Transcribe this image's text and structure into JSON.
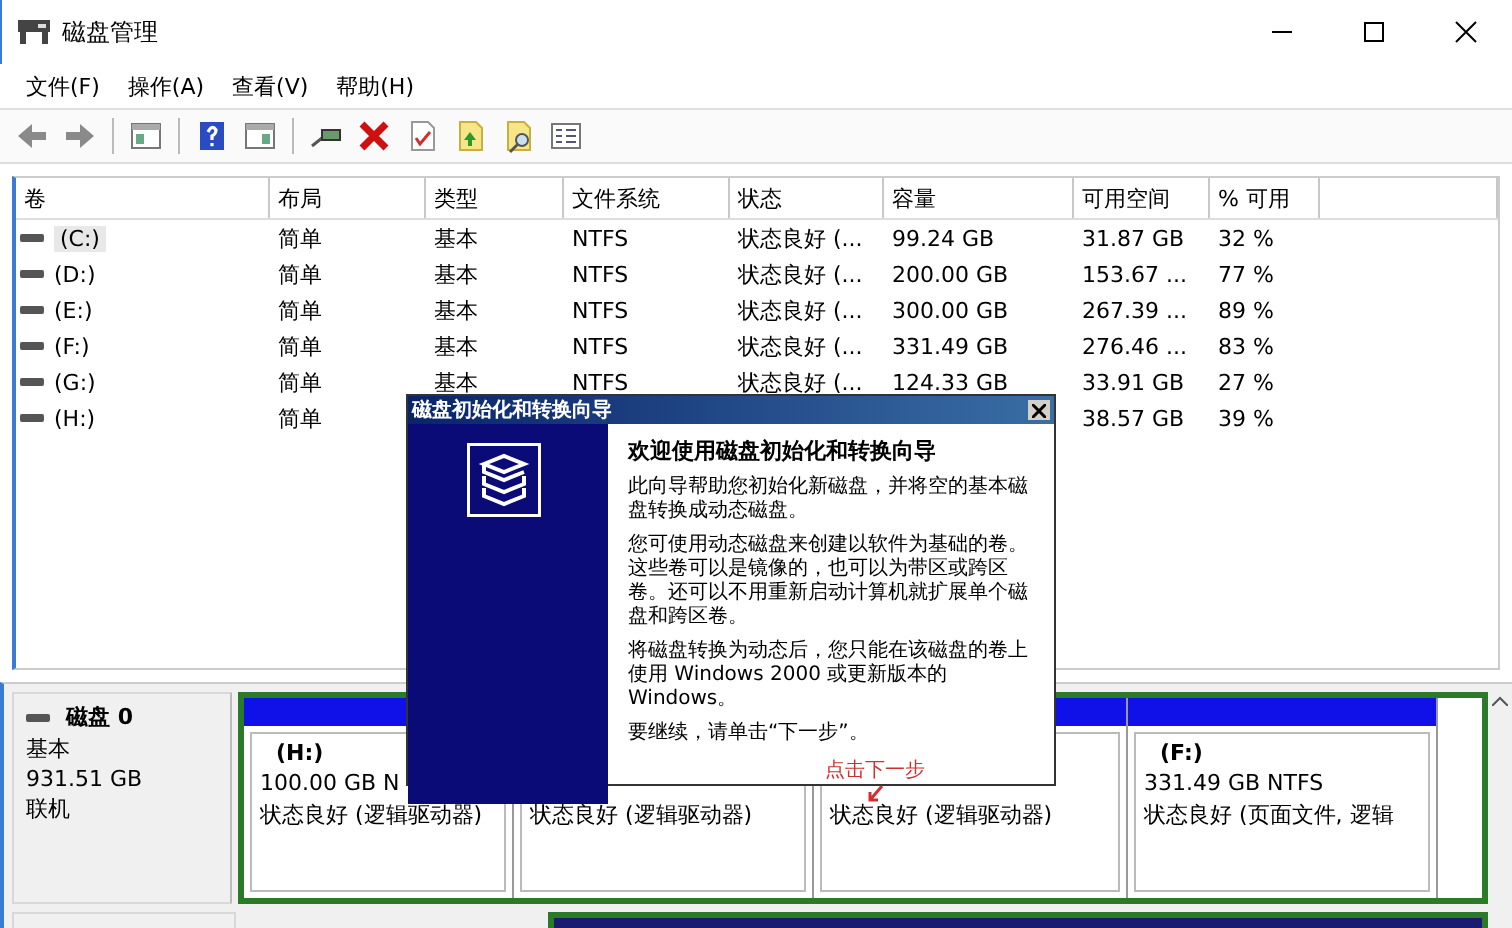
{
  "window": {
    "title": "磁盘管理"
  },
  "menu": [
    "文件(F)",
    "操作(A)",
    "查看(V)",
    "帮助(H)"
  ],
  "table": {
    "columns": [
      "卷",
      "布局",
      "类型",
      "文件系统",
      "状态",
      "容量",
      "可用空间",
      "% 可用"
    ],
    "rows": [
      {
        "selected": true,
        "cells": [
          "(C:)",
          "简单",
          "基本",
          "NTFS",
          "状态良好 (...",
          "99.24 GB",
          "31.87 GB",
          "32 %"
        ]
      },
      {
        "selected": false,
        "cells": [
          "(D:)",
          "简单",
          "基本",
          "NTFS",
          "状态良好 (...",
          "200.00 GB",
          "153.67 ...",
          "77 %"
        ]
      },
      {
        "selected": false,
        "cells": [
          "(E:)",
          "简单",
          "基本",
          "NTFS",
          "状态良好 (...",
          "300.00 GB",
          "267.39 ...",
          "89 %"
        ]
      },
      {
        "selected": false,
        "cells": [
          "(F:)",
          "简单",
          "基本",
          "NTFS",
          "状态良好 (...",
          "331.49 GB",
          "276.46 ...",
          "83 %"
        ]
      },
      {
        "selected": false,
        "cells": [
          "(G:)",
          "简单",
          "基本",
          "NTFS",
          "状态良好 (...",
          "124.33 GB",
          "33.91 GB",
          "27 %"
        ]
      },
      {
        "selected": false,
        "cells": [
          "(H:)",
          "简单",
          null,
          null,
          null,
          null,
          "38.57 GB",
          "39 %"
        ]
      }
    ]
  },
  "disk": {
    "name": "磁盘 0",
    "type": "基本",
    "size": "931.51 GB",
    "status": "联机",
    "partitions": [
      {
        "name": "(H:)",
        "size": "100.00 GB N",
        "status": "状态良好 (逻辑驱动器)"
      },
      {
        "status": "状态良好 (逻辑驱动器)"
      },
      {
        "status": "状态良好 (逻辑驱动器)"
      },
      {
        "name": "(F:)",
        "size": "331.49 GB NTFS",
        "status": "状态良好 (页面文件, 逻辑"
      }
    ]
  },
  "wizard": {
    "title": "磁盘初始化和转换向导",
    "heading": "欢迎使用磁盘初始化和转换向导",
    "paragraphs": [
      "此向导帮助您初始化新磁盘，并将空的基本磁盘转换成动态磁盘。",
      "您可使用动态磁盘来创建以软件为基础的卷。这些卷可以是镜像的，也可以为带区或跨区卷。还可以不用重新启动计算机就扩展单个磁盘和跨区卷。",
      "将磁盘转换为动态后，您只能在该磁盘的卷上使用 Windows 2000 或更新版本的 Windows。",
      "要继续，请单击“下一步”。"
    ],
    "annotation": "点击下一步"
  }
}
